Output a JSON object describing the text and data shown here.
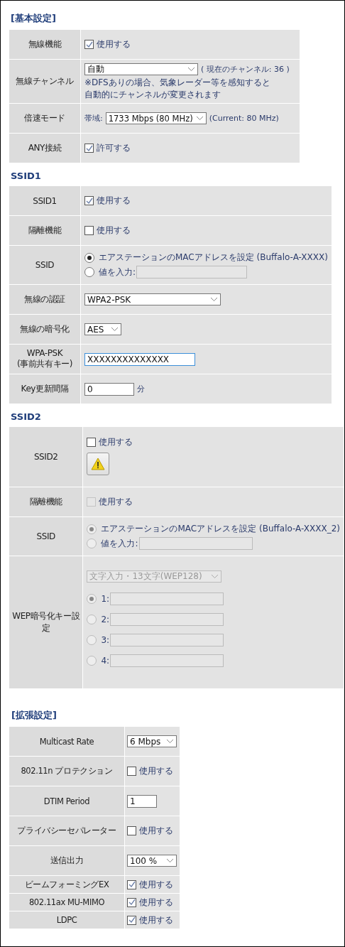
{
  "sections": [
    {
      "title": "[基本設定]",
      "rows": [
        {
          "label": "無線機能",
          "controls": [
            {
              "kind": "checkbox",
              "label": "使用する",
              "checked": true,
              "disabled": false
            }
          ]
        },
        {
          "label": "無線チャンネル",
          "controls": [
            {
              "kind": "select",
              "value": "自動",
              "suffix": "( 現在のチャンネル:  36 )",
              "disabled": false
            },
            {
              "kind": "note",
              "text": "※DFSありの場合、気象レーダー等を感知すると"
            },
            {
              "kind": "note",
              "text": "自動的にチャンネルが変更されます"
            }
          ]
        },
        {
          "label": "倍速モード",
          "controls": [
            {
              "kind": "select",
              "prefix": "帯域:",
              "value": "1733 Mbps (80 MHz)",
              "suffix": "(Current: 80 MHz)",
              "disabled": false
            }
          ]
        },
        {
          "label": "ANY接続",
          "controls": [
            {
              "kind": "checkbox",
              "label": "許可する",
              "checked": true,
              "disabled": false
            }
          ]
        }
      ]
    },
    {
      "title": "SSID1",
      "rows": [
        {
          "label": "SSID1",
          "controls": [
            {
              "kind": "checkbox",
              "label": "使用する",
              "checked": true,
              "disabled": false
            }
          ]
        },
        {
          "label": "隔離機能",
          "controls": [
            {
              "kind": "checkbox",
              "label": "使用する",
              "checked": false,
              "disabled": false
            }
          ]
        },
        {
          "label": "SSID",
          "controls": [
            {
              "kind": "radio",
              "label": "エアステーションのMACアドレスを設定 (Buffalo-A-XXXX)",
              "selected": true,
              "disabled": false
            },
            {
              "kind": "radio_field",
              "label": "値を入力:",
              "selected": false,
              "disabled": false
            }
          ]
        },
        {
          "label": "無線の認証",
          "controls": [
            {
              "kind": "select",
              "value": "WPA2-PSK",
              "disabled": false
            }
          ]
        },
        {
          "label": "無線の暗号化",
          "controls": [
            {
              "kind": "select",
              "value": "AES",
              "disabled": false
            }
          ]
        },
        {
          "label": "WPA-PSK\n(事前共有キー)",
          "controls": [
            {
              "kind": "input",
              "value": "XXXXXXXXXXXXXX",
              "focused": true
            }
          ]
        },
        {
          "label": "Key更新間隔",
          "controls": [
            {
              "kind": "input",
              "value": "0",
              "suffix": "分",
              "focused": false
            }
          ]
        }
      ]
    },
    {
      "title": "SSID2",
      "rows": [
        {
          "label": "SSID2",
          "controls": [
            {
              "kind": "checkbox",
              "label": "使用する",
              "checked": false,
              "disabled": false
            },
            {
              "kind": "warning_button"
            }
          ]
        },
        {
          "label": "隔離機能",
          "controls": [
            {
              "kind": "checkbox",
              "label": "使用する",
              "checked": false,
              "disabled": true
            }
          ]
        },
        {
          "label": "SSID",
          "controls": [
            {
              "kind": "radio",
              "label": "エアステーションのMACアドレスを設定 (Buffalo-A-XXXX_2)",
              "selected": true,
              "disabled": true
            },
            {
              "kind": "radio_field",
              "label": "値を入力:",
              "selected": false,
              "disabled": true
            }
          ]
        },
        {
          "label": "WEP暗号化キー設定",
          "controls": [
            {
              "kind": "select",
              "value": "文字入力・13文字(WEP128)",
              "disabled": true
            },
            {
              "kind": "radio_field",
              "label": "1:",
              "selected": true,
              "disabled": true
            },
            {
              "kind": "radio_field",
              "label": "2:",
              "selected": false,
              "disabled": true
            },
            {
              "kind": "radio_field",
              "label": "3:",
              "selected": false,
              "disabled": true
            },
            {
              "kind": "radio_field",
              "label": "4:",
              "selected": false,
              "disabled": true
            }
          ]
        }
      ]
    },
    {
      "title": "[拡張設定]",
      "rows": [
        {
          "label": "Multicast Rate",
          "controls": [
            {
              "kind": "select",
              "value": "6 Mbps",
              "disabled": false
            }
          ]
        },
        {
          "label": "802.11n プロテクション",
          "controls": [
            {
              "kind": "checkbox",
              "label": "使用する",
              "checked": false,
              "disabled": false
            }
          ]
        },
        {
          "label": "DTIM Period",
          "controls": [
            {
              "kind": "input",
              "value": "1",
              "focused": false
            }
          ]
        },
        {
          "label": "プライバシーセパレーター",
          "controls": [
            {
              "kind": "checkbox",
              "label": "使用する",
              "checked": false,
              "disabled": false
            }
          ]
        },
        {
          "label": "送信出力",
          "controls": [
            {
              "kind": "select",
              "value": "100 %",
              "disabled": false
            }
          ]
        },
        {
          "label": "ビームフォーミングEX",
          "controls": [
            {
              "kind": "checkbox",
              "label": "使用する",
              "checked": true,
              "disabled": false
            }
          ]
        },
        {
          "label": "802.11ax MU-MIMO",
          "controls": [
            {
              "kind": "checkbox",
              "label": "使用する",
              "checked": true,
              "disabled": false
            }
          ]
        },
        {
          "label": "LDPC",
          "controls": [
            {
              "kind": "checkbox",
              "label": "使用する",
              "checked": true,
              "disabled": false
            }
          ]
        }
      ]
    }
  ]
}
